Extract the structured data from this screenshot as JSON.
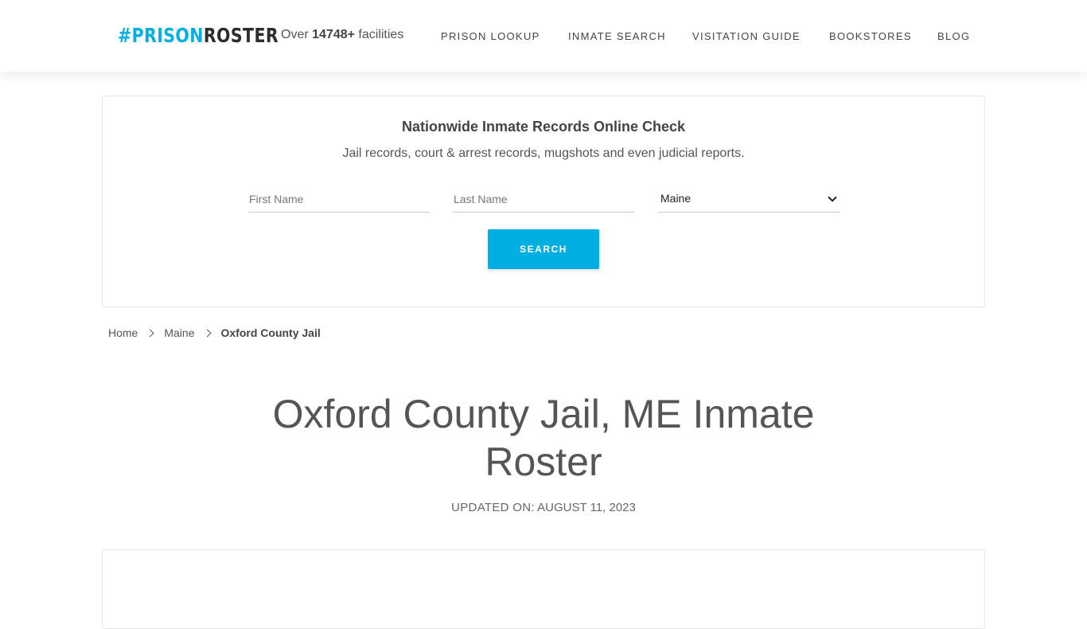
{
  "header": {
    "logo": {
      "hash": "#",
      "prison": "PRISON",
      "roster": "ROSTER"
    },
    "facilities": {
      "prefix": "Over",
      "count": "14748+",
      "suffix": "facilities"
    },
    "nav": [
      {
        "label": "PRISON LOOKUP"
      },
      {
        "label": "INMATE SEARCH"
      },
      {
        "label": "VISITATION GUIDE"
      },
      {
        "label": "BOOKSTORES"
      },
      {
        "label": "BLOG"
      }
    ]
  },
  "search_card": {
    "title": "Nationwide Inmate Records Online Check",
    "subtitle": "Jail records, court & arrest records, mugshots and even judicial reports.",
    "first_name_placeholder": "First Name",
    "last_name_placeholder": "Last Name",
    "state_selected": "Maine",
    "search_label": "SEARCH"
  },
  "breadcrumb": {
    "items": [
      {
        "label": "Home"
      },
      {
        "label": "Maine"
      }
    ],
    "current": "Oxford County Jail"
  },
  "page": {
    "title": "Oxford County Jail, ME Inmate Roster",
    "updated_label": "UPDATED ON:",
    "updated_date": "AUGUST 11, 2023"
  },
  "colors": {
    "accent": "#00aee1",
    "text": "#555555",
    "border": "#e6e6e6"
  }
}
